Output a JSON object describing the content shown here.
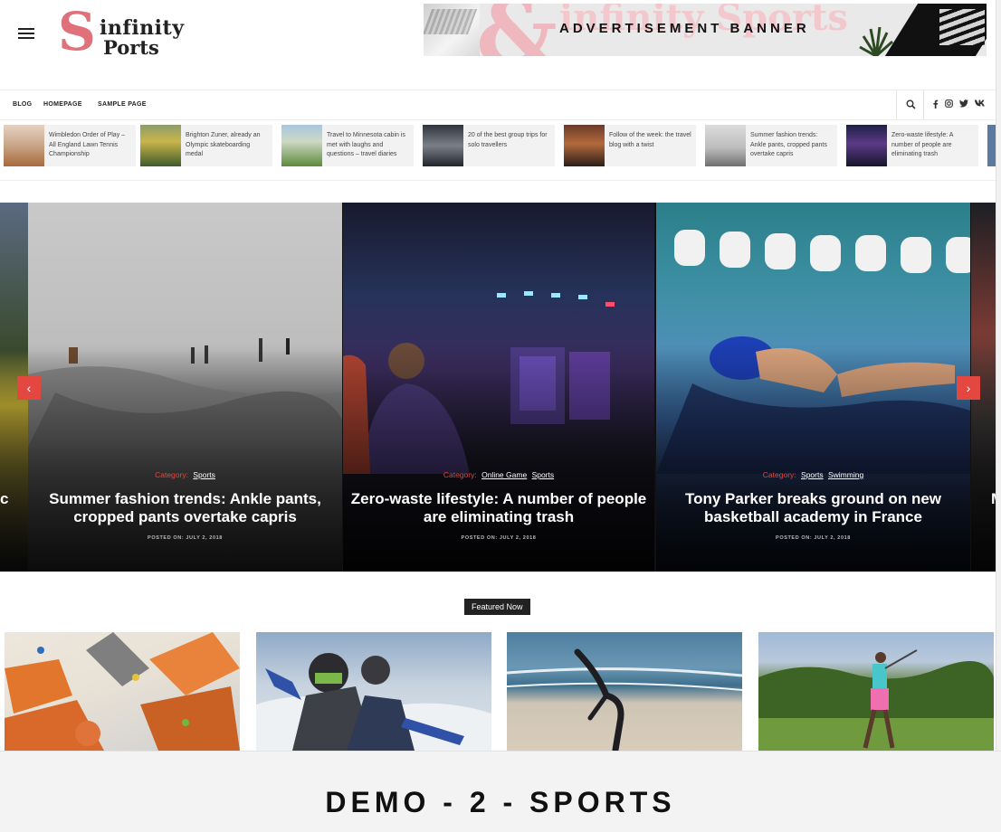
{
  "header": {
    "logo": {
      "letter": "S",
      "line1": "infinity",
      "line2": "Ports"
    },
    "ad_banner": {
      "text": "ADVERTISEMENT BANNER",
      "ghost_text": "infinity Sports"
    }
  },
  "nav": {
    "links": [
      "BLOG",
      "HOMEPAGE",
      "SAMPLE PAGE"
    ],
    "icons": [
      "search-icon",
      "facebook-icon",
      "instagram-icon",
      "twitter-icon",
      "vk-icon"
    ]
  },
  "ticker": {
    "items": [
      {
        "text": "Wimbledon Order of Play – All England Lawn Tennis Championship"
      },
      {
        "text": "Brighton Zuner, already an Olympic skateboarding medal"
      },
      {
        "text": "Travel to Minnesota cabin is met with laughs and questions – travel diaries"
      },
      {
        "text": "20 of the best group trips for solo travellers"
      },
      {
        "text": "Follow of the week: the travel blog with a twist"
      },
      {
        "text": "Summer fashion trends: Ankle pants, cropped pants overtake capris"
      },
      {
        "text": "Zero-waste lifestyle: A number of people are eliminating trash"
      }
    ]
  },
  "slider": {
    "slides": [
      {
        "category_label": "Category:",
        "tags": [
          "Sports"
        ],
        "title": "Summer fashion trends: Ankle pants, cropped pants overtake capris",
        "date": "POSTED ON: JULY 2, 2018"
      },
      {
        "category_label": "Category:",
        "tags": [
          "Online Game",
          "Sports"
        ],
        "title": "Zero-waste lifestyle: A number of people are eliminating trash",
        "date": "POSTED ON: JULY 2, 2018"
      },
      {
        "category_label": "Category:",
        "tags": [
          "Sports",
          "Swimming"
        ],
        "title": "Tony Parker breaks ground on new basketball academy in France",
        "date": "POSTED ON: JULY 2, 2018"
      }
    ],
    "partial_left_text": "c",
    "partial_right_text": "M",
    "prev_arrow": "‹",
    "next_arrow": "›"
  },
  "featured": {
    "label": "Featured Now",
    "cards": [
      "climbing-wall-image",
      "motocross-riders-image",
      "beach-handstand-image",
      "golf-swing-image"
    ]
  },
  "footer": {
    "title": "DEMO - 2 - SPORTS"
  },
  "colors": {
    "accent": "#e3473f",
    "logo_pink": "#e0707a",
    "dark": "#222222"
  }
}
